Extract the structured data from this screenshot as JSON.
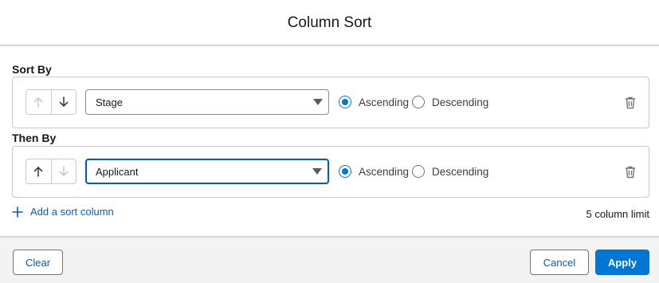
{
  "dialog": {
    "title": "Column Sort"
  },
  "sort_by": {
    "label": "Sort By",
    "field": "Stage",
    "direction": "Ascending",
    "options": {
      "ascending": "Ascending",
      "descending": "Descending"
    },
    "up_enabled": false,
    "down_enabled": true
  },
  "then_by": {
    "label": "Then By",
    "field": "Applicant",
    "direction": "Ascending",
    "options": {
      "ascending": "Ascending",
      "descending": "Descending"
    },
    "up_enabled": true,
    "down_enabled": false
  },
  "add_sort": {
    "label": "Add a sort column",
    "icon": "plus-icon"
  },
  "limit_text": "5 column limit",
  "footer": {
    "clear": "Clear",
    "cancel": "Cancel",
    "apply": "Apply"
  },
  "colors": {
    "brand": "#0176d3",
    "link": "#0b5cab",
    "border": "#c9c9c9",
    "footer_bg": "#f3f3f3"
  }
}
